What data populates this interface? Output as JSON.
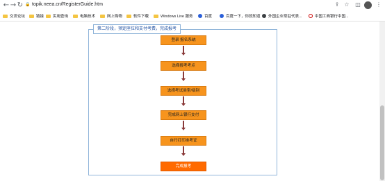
{
  "browser": {
    "url": "topik.neea.cn/RegisterGuide.htm",
    "nav_icons": [
      "back-icon",
      "forward-icon",
      "reload-icon"
    ],
    "right_icons": [
      "share-icon",
      "star-icon",
      "sidebar-icon",
      "profile-avatar",
      "menu-icon"
    ]
  },
  "bookmarks": [
    {
      "label": "交流论坛",
      "icon": "folder"
    },
    {
      "label": "链接",
      "icon": "folder"
    },
    {
      "label": "实用查询",
      "icon": "folder"
    },
    {
      "label": "电脑技术",
      "icon": "folder"
    },
    {
      "label": "网上购物",
      "icon": "folder"
    },
    {
      "label": "软件下载",
      "icon": "folder"
    },
    {
      "label": "Windows Live 服务",
      "icon": "folder"
    },
    {
      "label": "百度",
      "icon": "paw"
    },
    {
      "label": "百度一下，你就知道",
      "icon": "paw"
    },
    {
      "label": "外国企业常驻代表...",
      "icon": "globe"
    },
    {
      "label": "中国工商银行中国...",
      "icon": "bank"
    }
  ],
  "page": {
    "section_title": "第二阶段，预定座位和支付考费，完成报考",
    "steps": [
      "登录 报名系统",
      "选择报考考点",
      "选择考试类型/级别",
      "完成网上银行支付",
      "自行打印准考证"
    ],
    "final_step": "完成报考"
  },
  "colors": {
    "step_fill": "#f7941d",
    "final_fill": "#ff6a00",
    "arrow": "#8a3a3a",
    "border": "#8fb4d9",
    "title_text": "#1e50a2"
  }
}
